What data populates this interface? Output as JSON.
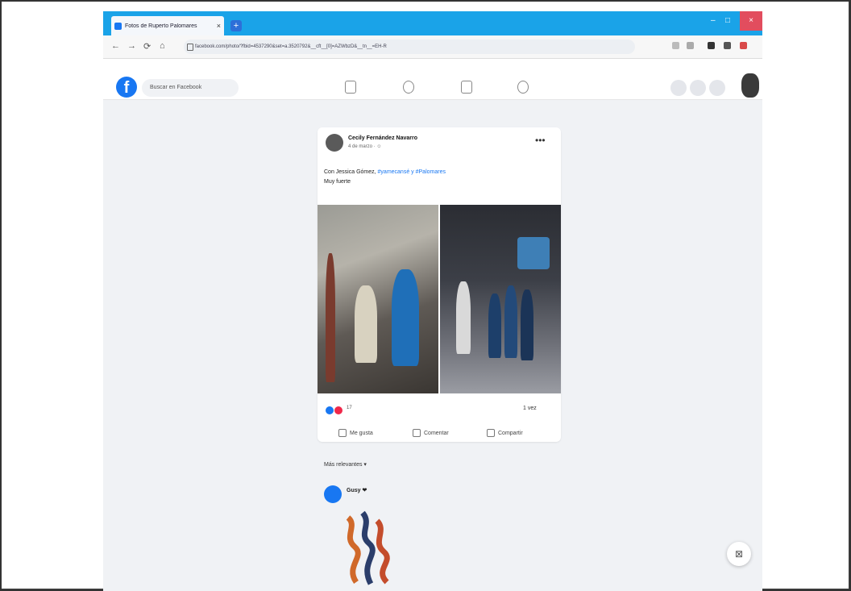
{
  "browser": {
    "tab_title": "Fotos de Ruperto Palomares",
    "tab_close": "×",
    "new_tab": "+",
    "window_controls": [
      "–",
      "□",
      "×"
    ],
    "nav": [
      "←",
      "→",
      "⟳",
      "⌂"
    ],
    "url": "facebook.com/photo/?fbid=4537290&set=a.3520792&__cft__[0]=AZWbzD&__tn__=EH-R"
  },
  "facebook": {
    "logo_letter": "f",
    "search_placeholder": "Buscar en Facebook"
  },
  "post": {
    "author": "Cecily Fernández Navarro",
    "timestamp": "4 de marzo · ☺",
    "text_prefix": "Con Jessica Gómez, ",
    "mention": "#yamecansé y ",
    "hashtag": "#Palomares",
    "text_suffix": "Muy fuerte",
    "reaction_count": "17",
    "share_count": "1 vez",
    "actions": [
      "Me gusta",
      "Comentar",
      "Compartir"
    ]
  },
  "comments": {
    "toggle": "Más relevantes ▾",
    "first_commenter": "Gusy ❤"
  }
}
